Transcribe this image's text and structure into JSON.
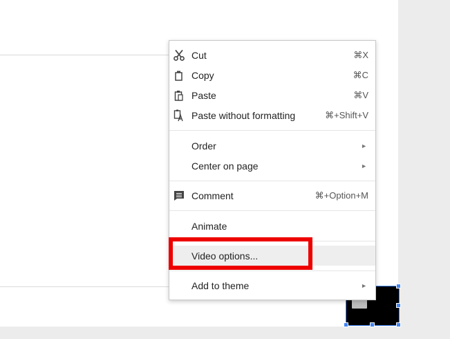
{
  "menu": {
    "items": [
      {
        "label": "Cut",
        "shortcut": "⌘X",
        "icon": "scissors-icon"
      },
      {
        "label": "Copy",
        "shortcut": "⌘C",
        "icon": "copy-icon"
      },
      {
        "label": "Paste",
        "shortcut": "⌘V",
        "icon": "paste-icon"
      },
      {
        "label": "Paste without formatting",
        "shortcut": "⌘+Shift+V",
        "icon": "paste-plain-icon"
      },
      {
        "label": "Order",
        "submenu": "►"
      },
      {
        "label": "Center on page",
        "submenu": "►"
      },
      {
        "label": "Comment",
        "shortcut": "⌘+Option+M",
        "icon": "comment-icon"
      },
      {
        "label": "Animate"
      },
      {
        "label": "Video options..."
      },
      {
        "label": "Add to theme",
        "submenu": "►"
      }
    ]
  },
  "colors": {
    "highlight": "#ee0000",
    "selection": "#4285f4",
    "hover": "#eeeeee"
  }
}
